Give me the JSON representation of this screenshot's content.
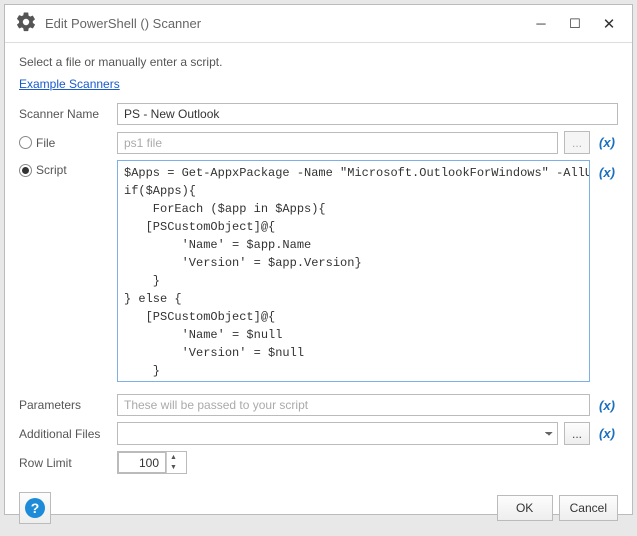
{
  "title": "Edit PowerShell () Scanner",
  "instruction": "Select a file or manually enter a script.",
  "example_link": "Example Scanners",
  "labels": {
    "scanner_name": "Scanner Name",
    "file": "File",
    "script": "Script",
    "parameters": "Parameters",
    "additional_files": "Additional Files",
    "row_limit": "Row Limit"
  },
  "fields": {
    "scanner_name": "PS - New Outlook",
    "file_placeholder": "ps1 file",
    "script": "$Apps = Get-AppxPackage -Name \"Microsoft.OutlookForWindows\" -AllUsers\nif($Apps){\n    ForEach ($app in $Apps){\n   [PSCustomObject]@{\n        'Name' = $app.Name\n        'Version' = $app.Version}\n    }\n} else {\n   [PSCustomObject]@{\n        'Name' = $null\n        'Version' = $null\n    }\n}",
    "parameters_placeholder": "These will be passed to your script",
    "row_limit": "100"
  },
  "buttons": {
    "ok": "OK",
    "cancel": "Cancel",
    "browse": "...",
    "help": "?",
    "var": "(x)"
  },
  "selected_source": "script"
}
